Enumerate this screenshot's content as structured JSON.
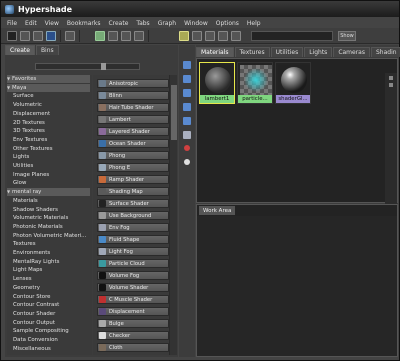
{
  "window": {
    "title": "Hypershade"
  },
  "menu": [
    "File",
    "Edit",
    "View",
    "Bookmarks",
    "Create",
    "Tabs",
    "Graph",
    "Window",
    "Options",
    "Help"
  ],
  "toolbar": {
    "show_label": "Show",
    "search_value": ""
  },
  "left_tabs": [
    {
      "label": "Create",
      "active": true
    },
    {
      "label": "Bins",
      "active": false
    }
  ],
  "tree": [
    {
      "label": "Favorites",
      "type": "header",
      "expanded": true
    },
    {
      "label": "Maya",
      "type": "header",
      "expanded": true
    },
    {
      "label": "Surface",
      "type": "item"
    },
    {
      "label": "Volumetric",
      "type": "item"
    },
    {
      "label": "Displacement",
      "type": "item"
    },
    {
      "label": "2D Textures",
      "type": "item"
    },
    {
      "label": "3D Textures",
      "type": "item"
    },
    {
      "label": "Env Textures",
      "type": "item"
    },
    {
      "label": "Other Textures",
      "type": "item"
    },
    {
      "label": "Lights",
      "type": "item"
    },
    {
      "label": "Utilities",
      "type": "item"
    },
    {
      "label": "Image Planes",
      "type": "item"
    },
    {
      "label": "Glow",
      "type": "item"
    },
    {
      "label": "mental ray",
      "type": "header",
      "expanded": true
    },
    {
      "label": "Materials",
      "type": "item"
    },
    {
      "label": "Shadow Shaders",
      "type": "item"
    },
    {
      "label": "Volumetric Materials",
      "type": "item"
    },
    {
      "label": "Photonic Materials",
      "type": "item"
    },
    {
      "label": "Photon Volumetric Materi...",
      "type": "item"
    },
    {
      "label": "Textures",
      "type": "item"
    },
    {
      "label": "Environments",
      "type": "item"
    },
    {
      "label": "MentalRay Lights",
      "type": "item"
    },
    {
      "label": "Light Maps",
      "type": "item"
    },
    {
      "label": "Lenses",
      "type": "item"
    },
    {
      "label": "Geometry",
      "type": "item"
    },
    {
      "label": "Contour Store",
      "type": "item"
    },
    {
      "label": "Contour Contrast",
      "type": "item"
    },
    {
      "label": "Contour Shader",
      "type": "item"
    },
    {
      "label": "Contour Output",
      "type": "item"
    },
    {
      "label": "Sample Compositing",
      "type": "item"
    },
    {
      "label": "Data Conversion",
      "type": "item"
    },
    {
      "label": "Miscellaneous",
      "type": "item"
    }
  ],
  "shelf": [
    {
      "label": "Anisotropic",
      "icon": "anisotropic-icon",
      "color": "#6a7a8a"
    },
    {
      "label": "Blinn",
      "icon": "blinn-icon",
      "color": "#7a8a9a"
    },
    {
      "label": "Hair Tube Shader",
      "icon": "hair-tube-icon",
      "color": "#8a7060"
    },
    {
      "label": "Lambert",
      "icon": "lambert-icon",
      "color": "#777777"
    },
    {
      "label": "Layered Shader",
      "icon": "layered-shader-icon",
      "color": "#8a6a9a"
    },
    {
      "label": "Ocean Shader",
      "icon": "ocean-shader-icon",
      "color": "#3a6fa8"
    },
    {
      "label": "Phong",
      "icon": "phong-icon",
      "color": "#8898a8"
    },
    {
      "label": "Phong E",
      "icon": "phong-e-icon",
      "color": "#98a8b8"
    },
    {
      "label": "Ramp Shader",
      "icon": "ramp-shader-icon",
      "color": "#c86a3a"
    },
    {
      "label": "Shading Map",
      "icon": "shading-map-icon",
      "color": "#5a5a5a"
    },
    {
      "label": "Surface Shader",
      "icon": "surface-shader-icon",
      "color": "#222222"
    },
    {
      "label": "Use Background",
      "icon": "use-background-icon",
      "color": "#999999"
    },
    {
      "label": "Env Fog",
      "icon": "env-fog-icon",
      "color": "#9aa0b0"
    },
    {
      "label": "Fluid Shape",
      "icon": "fluid-shape-icon",
      "color": "#4a8ac8"
    },
    {
      "label": "Light Fog",
      "icon": "light-fog-icon",
      "color": "#a0a8b8"
    },
    {
      "label": "Particle Cloud",
      "icon": "particle-cloud-icon",
      "color": "#3a9aa0"
    },
    {
      "label": "Volume Fog",
      "icon": "volume-fog-icon",
      "color": "#111111"
    },
    {
      "label": "Volume Shader",
      "icon": "volume-shader-icon",
      "color": "#111111"
    },
    {
      "label": "C Muscle Shader",
      "icon": "muscle-shader-icon",
      "color": "#c03030"
    },
    {
      "label": "Displacement",
      "icon": "displacement-icon",
      "color": "#5a4a7a"
    },
    {
      "label": "Bulge",
      "icon": "bulge-icon",
      "color": "#aaaaaa"
    },
    {
      "label": "Checker",
      "icon": "checker-icon",
      "color": "#dddddd"
    },
    {
      "label": "Cloth",
      "icon": "cloth-icon",
      "color": "#7a6a5a"
    }
  ],
  "right_tabs": [
    {
      "label": "Materials",
      "active": true
    },
    {
      "label": "Textures",
      "active": false
    },
    {
      "label": "Utilities",
      "active": false
    },
    {
      "label": "Lights",
      "active": false
    },
    {
      "label": "Cameras",
      "active": false
    },
    {
      "label": "Shadin",
      "active": false
    }
  ],
  "materials": [
    {
      "name": "lambert1",
      "swatch": "lambert",
      "label_bg": "#7fd67f"
    },
    {
      "name": "particle...",
      "swatch": "particle",
      "label_bg": "#7fd67f"
    },
    {
      "name": "shaderGl...",
      "swatch": "glossy",
      "label_bg": "#9a8ad0"
    }
  ],
  "work_area": {
    "tab_label": "Work Area"
  },
  "colors": {
    "accent_selected_border": "#e6e64a",
    "panel": "#3c3c3c",
    "viewport": "#232323"
  }
}
